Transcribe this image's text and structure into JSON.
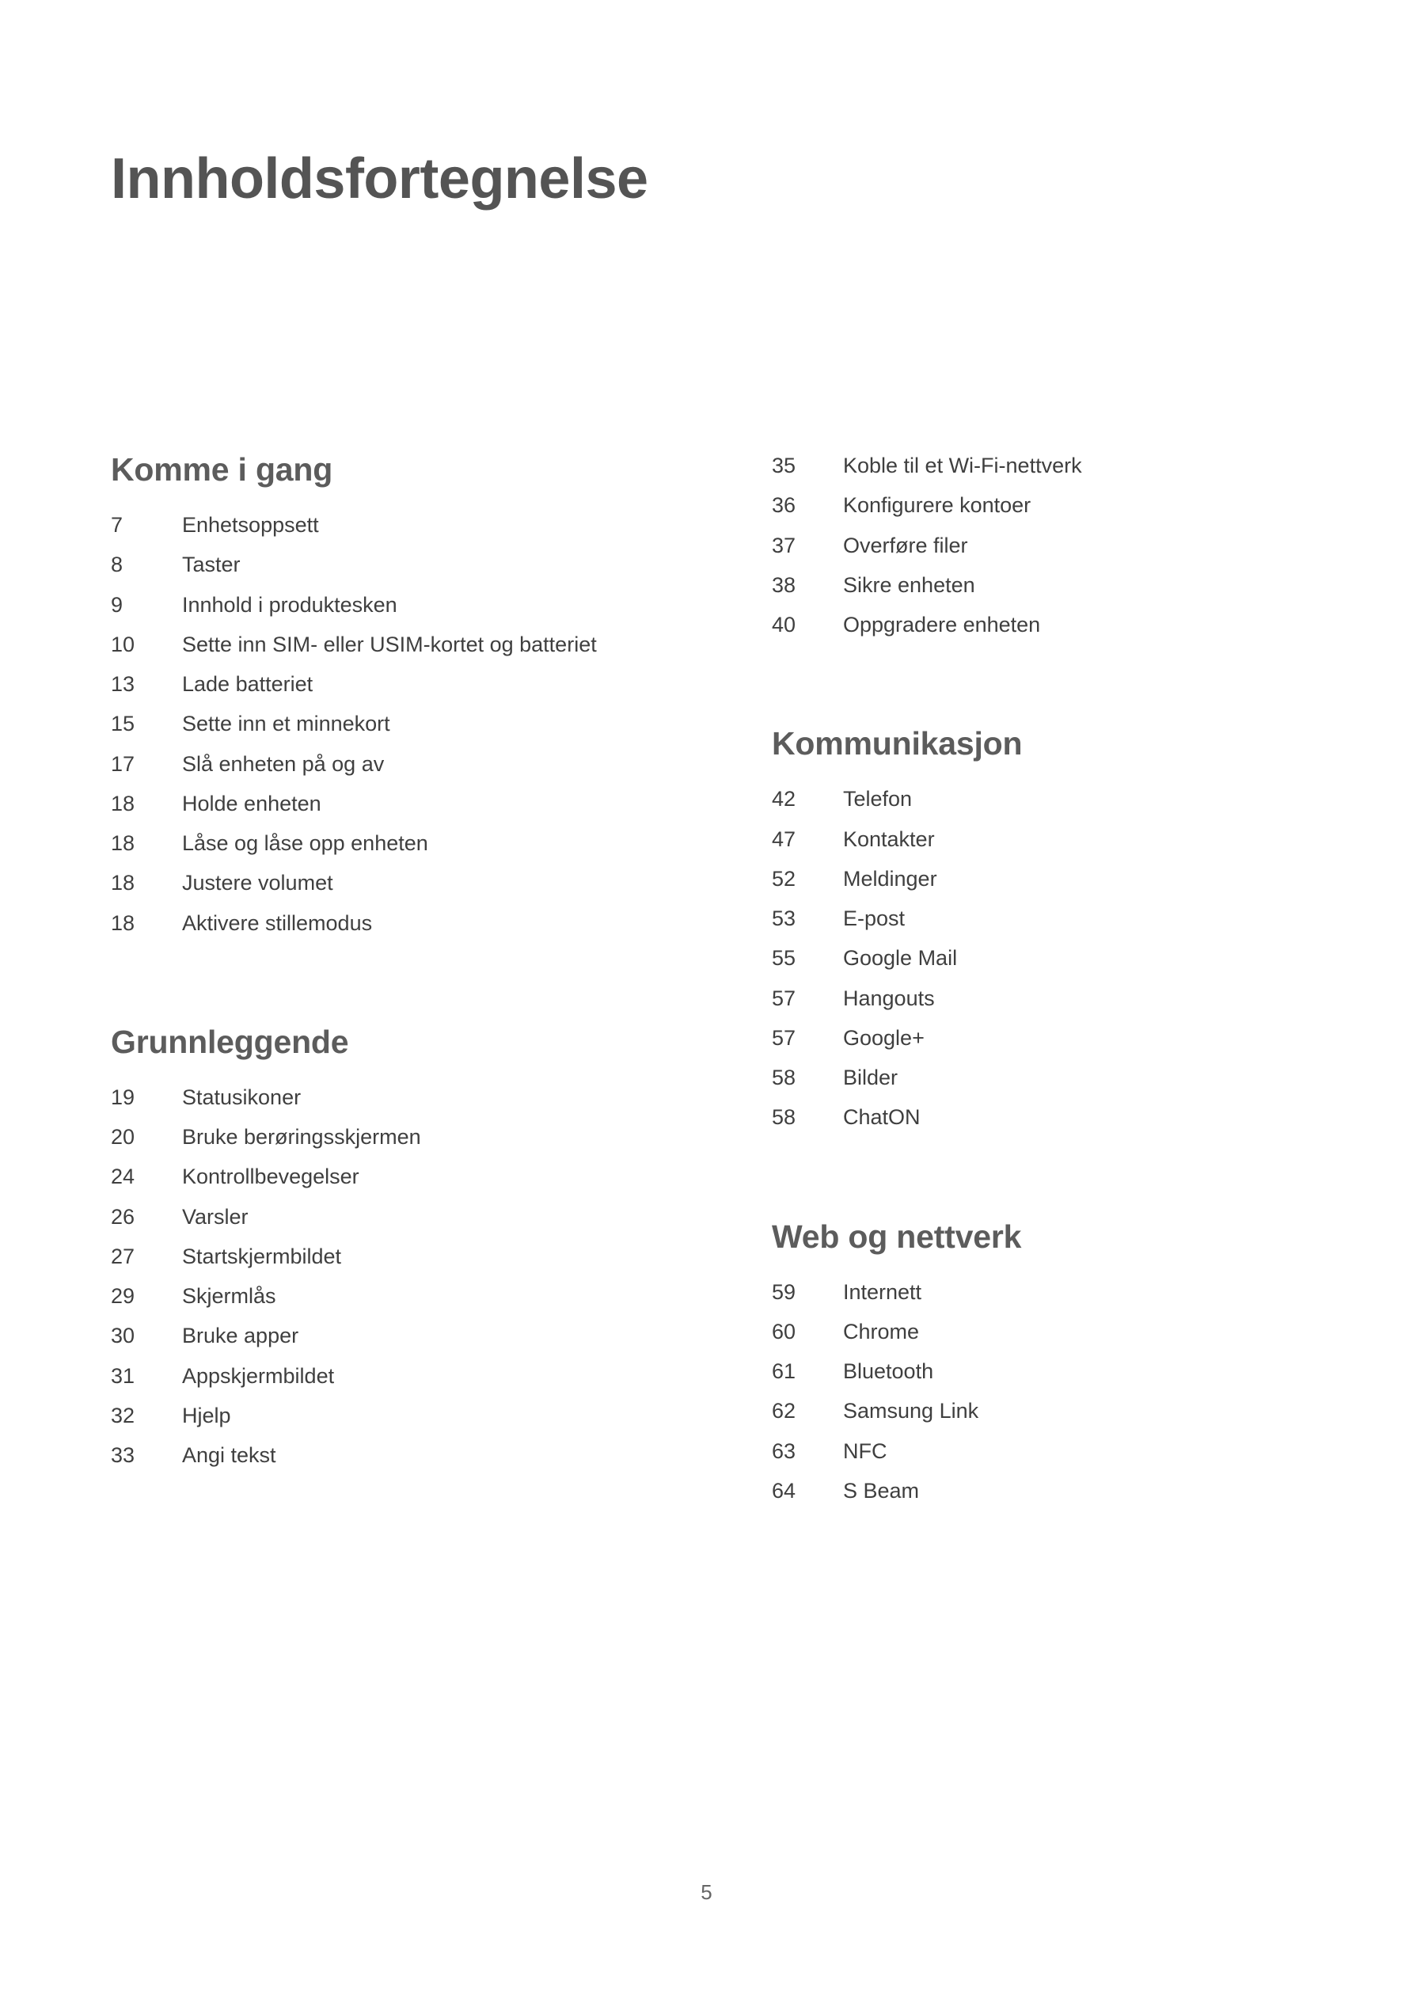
{
  "document": {
    "title": "Innholdsfortegnelse",
    "page_number": "5"
  },
  "left_column": [
    {
      "heading": "Komme i gang",
      "entries": [
        {
          "page": "7",
          "label": "Enhetsoppsett"
        },
        {
          "page": "8",
          "label": "Taster"
        },
        {
          "page": "9",
          "label": "Innhold i produktesken"
        },
        {
          "page": "10",
          "label": "Sette inn SIM- eller USIM-kortet og batteriet"
        },
        {
          "page": "13",
          "label": "Lade batteriet"
        },
        {
          "page": "15",
          "label": "Sette inn et minnekort"
        },
        {
          "page": "17",
          "label": "Slå enheten på og av"
        },
        {
          "page": "18",
          "label": "Holde enheten"
        },
        {
          "page": "18",
          "label": "Låse og låse opp enheten"
        },
        {
          "page": "18",
          "label": "Justere volumet"
        },
        {
          "page": "18",
          "label": "Aktivere stillemodus"
        }
      ]
    },
    {
      "heading": "Grunnleggende",
      "entries": [
        {
          "page": "19",
          "label": "Statusikoner"
        },
        {
          "page": "20",
          "label": "Bruke berøringsskjermen"
        },
        {
          "page": "24",
          "label": "Kontrollbevegelser"
        },
        {
          "page": "26",
          "label": "Varsler"
        },
        {
          "page": "27",
          "label": "Startskjermbildet"
        },
        {
          "page": "29",
          "label": "Skjermlås"
        },
        {
          "page": "30",
          "label": "Bruke apper"
        },
        {
          "page": "31",
          "label": "Appskjermbildet"
        },
        {
          "page": "32",
          "label": "Hjelp"
        },
        {
          "page": "33",
          "label": "Angi tekst"
        }
      ]
    }
  ],
  "right_column": [
    {
      "heading": "",
      "entries": [
        {
          "page": "35",
          "label": "Koble til et Wi-Fi-nettverk"
        },
        {
          "page": "36",
          "label": "Konfigurere kontoer"
        },
        {
          "page": "37",
          "label": "Overføre filer"
        },
        {
          "page": "38",
          "label": "Sikre enheten"
        },
        {
          "page": "40",
          "label": "Oppgradere enheten"
        }
      ]
    },
    {
      "heading": "Kommunikasjon",
      "entries": [
        {
          "page": "42",
          "label": "Telefon"
        },
        {
          "page": "47",
          "label": "Kontakter"
        },
        {
          "page": "52",
          "label": "Meldinger"
        },
        {
          "page": "53",
          "label": "E-post"
        },
        {
          "page": "55",
          "label": "Google Mail"
        },
        {
          "page": "57",
          "label": "Hangouts"
        },
        {
          "page": "57",
          "label": "Google+"
        },
        {
          "page": "58",
          "label": "Bilder"
        },
        {
          "page": "58",
          "label": "ChatON"
        }
      ]
    },
    {
      "heading": "Web og nettverk",
      "entries": [
        {
          "page": "59",
          "label": "Internett"
        },
        {
          "page": "60",
          "label": "Chrome"
        },
        {
          "page": "61",
          "label": "Bluetooth"
        },
        {
          "page": "62",
          "label": "Samsung Link"
        },
        {
          "page": "63",
          "label": "NFC"
        },
        {
          "page": "64",
          "label": "S Beam"
        }
      ]
    }
  ]
}
